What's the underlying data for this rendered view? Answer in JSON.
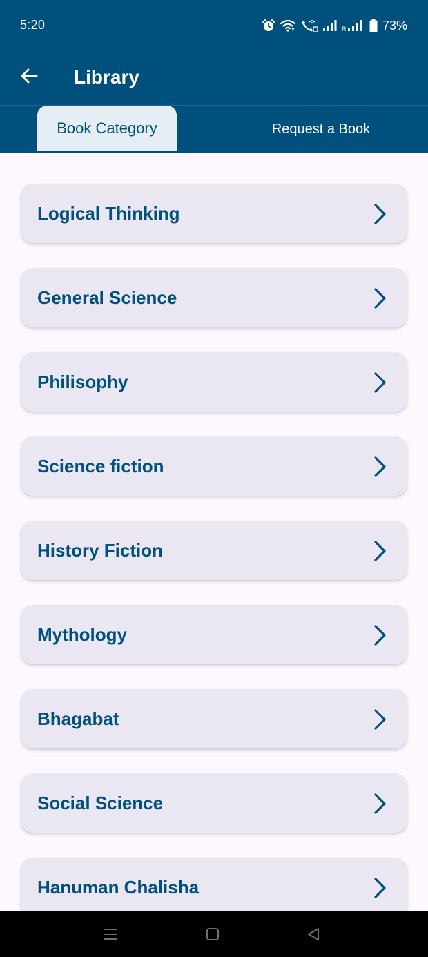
{
  "status_bar": {
    "time": "5:20",
    "battery": "73%",
    "icons": [
      "alarm-icon",
      "wifi-icon",
      "wifi-calling-icon",
      "signal-icon",
      "signal-roaming-icon",
      "battery-icon"
    ]
  },
  "app_bar": {
    "title": "Library",
    "back_icon": "arrow-left-icon"
  },
  "tabs": [
    {
      "label": "Book Category",
      "active": true
    },
    {
      "label": "Request a Book",
      "active": false
    }
  ],
  "categories": [
    {
      "label": "Logical Thinking"
    },
    {
      "label": "General Science"
    },
    {
      "label": "Philisophy"
    },
    {
      "label": "Science fiction"
    },
    {
      "label": "History Fiction"
    },
    {
      "label": "Mythology"
    },
    {
      "label": "Bhagabat"
    },
    {
      "label": "Social Science"
    },
    {
      "label": "Hanuman Chalisha"
    }
  ],
  "nav_bar": {
    "icons": [
      "menu-icon",
      "home-square-icon",
      "back-triangle-icon"
    ]
  },
  "colors": {
    "primary": "#00507E",
    "background": "#FCF8FD",
    "card": "#EAE7F2",
    "active_tab": "#E4EEF4"
  }
}
